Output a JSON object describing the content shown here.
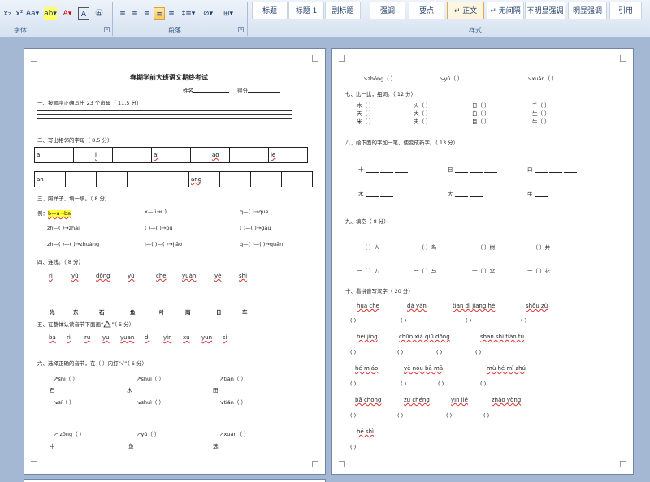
{
  "ribbon": {
    "font_buttons": [
      "x₂",
      "x²",
      "Aa▾",
      "ab▾",
      "A▾",
      "A",
      "㊄"
    ],
    "para_buttons": [
      "≡",
      "≡",
      "≡",
      "≡",
      "≡",
      "‡≡▾",
      "⊘▾",
      "⊞▾"
    ],
    "group_font": "字体",
    "group_paragraph": "段落",
    "group_styles": "样式",
    "styles": [
      "标题",
      "标题 1",
      "副标题",
      "强调",
      "要点",
      "↵ 正文",
      "↵ 无间隔",
      "不明显强调",
      "明显强调",
      "引用"
    ]
  },
  "left": {
    "title": "春期学前大班语文期终考试",
    "name_label": "姓名",
    "score_label": "得分",
    "q1": "一、按顺序正确写出 23 个声母（ 11.5 分）",
    "q2": "二、写出相邻的字母（ 8.5 分）",
    "grid1": [
      "a",
      "",
      "",
      "i",
      "",
      "",
      "ai",
      "",
      "",
      "ao",
      "",
      "",
      "ie",
      ""
    ],
    "grid2": [
      "an",
      "",
      "",
      "",
      "",
      "",
      "ang",
      "",
      "",
      ""
    ],
    "q3": "三、照样子，填一填。（ 8 分）",
    "ex_label": "例：",
    "ex_value": "b—a→ba",
    "r1": [
      "x—ü→(      )",
      "q—(      )→que"
    ],
    "r2": [
      "zh—(      )→zhai",
      "(      )—(      )→pu",
      "(      )—(      )→gāu"
    ],
    "r3": [
      "zh—(      )—(      )→zhuàng",
      "j—(      )—(      )→jiāo",
      "q—(      )—(      )→quān"
    ],
    "q4": "四、连线。（ 8 分）",
    "pinyin4": [
      "rì",
      "yǔ",
      "dōng",
      "yú",
      "chē",
      "yuán",
      "yè",
      "shí"
    ],
    "chars4": [
      "光",
      "东",
      "石",
      "鱼",
      "叶",
      "雨",
      "日",
      "车"
    ],
    "q5": "五、在整体认读音节下面画“",
    "q5_tail": "”（ 5 分）",
    "pinyin5": [
      "ba",
      "ri",
      "ru",
      "yu",
      "yuan",
      "di",
      "yin",
      "xu",
      "yun",
      "si"
    ],
    "q6": "六、选择正确的音节，在（      ）内打“√”（ 6 分）",
    "s6a": [
      "↗shí（      ）",
      "↗shuǐ（      ）",
      "↗tián（      ）"
    ],
    "c6a": [
      "石",
      "水",
      "田"
    ],
    "s6b": [
      "↘sí（      ）",
      "↘shuì（      ）",
      "↘tián（      ）"
    ],
    "s6c": [
      "↗ zōng（      ）",
      "↗yú（      ）",
      "↗xuán（      ）"
    ],
    "c6c": [
      "中",
      "鱼",
      "选"
    ]
  },
  "right": {
    "top_row": [
      "↘zhōng（      ）",
      "↘yú（      ）",
      "↘xuán（      ）"
    ],
    "q7": "七、比一比，组词。（ 12 分）",
    "q7_rows": [
      [
        "木（          ）",
        "火（          ）",
        "日（          ）",
        "千（          ）"
      ],
      [
        "天（          ）",
        "大（          ）",
        "白（          ）",
        "生（          ）"
      ],
      [
        "米（          ）",
        "夫（          ）",
        "目（          ）",
        "牛（          ）"
      ]
    ],
    "q8": "八、给下面的字加一笔，使变成新字。（ 13 分）",
    "q8_r1": [
      "十",
      "日",
      "口"
    ],
    "q8_r2": [
      "木",
      "大",
      "牛"
    ],
    "q9": "九、填空（ 8 分）",
    "q9_r1": [
      "一（   ）人",
      "一（   ）鸟",
      "一（   ）树",
      "一（   ）井"
    ],
    "q9_r2": [
      "一（   ）刀",
      "一（   ）马",
      "一（   ）伞",
      "一（   ）花"
    ],
    "q10": "十、看拼音写汉字（ 20 分）",
    "p10_1": [
      "huā  chē",
      "dà  yàn",
      "tiān  dì  jiāng  hé",
      "shōu  zǔ"
    ],
    "p10_2": [
      "bèi  jǐng",
      "chūn  xià  qiū  dōng",
      "shān  shí  tián  tǔ"
    ],
    "p10_3": [
      "hé  miáo",
      "yè  nóu  bā  mā",
      "mù  hé  mǐ  zhú"
    ],
    "p10_4": [
      "bā  chōng",
      "zú  chéng",
      "yīn  jié",
      "zhǎo  yòng"
    ],
    "p10_5": [
      "hé  shì"
    ],
    "paren": "(          )"
  }
}
